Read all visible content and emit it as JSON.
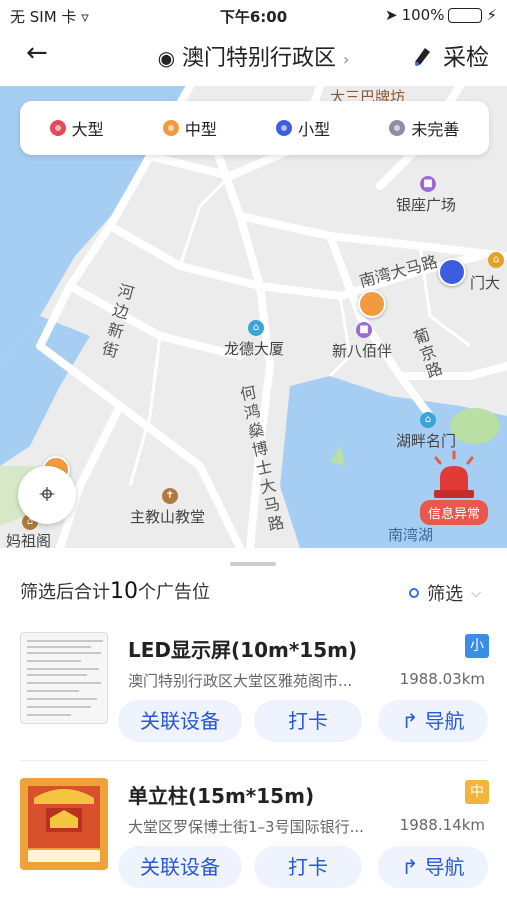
{
  "status": {
    "carrier": "无 SIM 卡",
    "time": "下午6:00",
    "battery": "100%",
    "battery_level": 1.0
  },
  "nav": {
    "back_icon": "arrow-left-icon",
    "location": "澳门特别行政区",
    "collect_label": "采检"
  },
  "legend": [
    {
      "label": "大型",
      "color": "#e24a57"
    },
    {
      "label": "中型",
      "color": "#f19a3e"
    },
    {
      "label": "小型",
      "color": "#3c5de0"
    },
    {
      "label": "未完善",
      "color": "#8a8fa6"
    }
  ],
  "map": {
    "labels": {
      "top_street": "大三巴牌坊",
      "mall": "银座广场",
      "nanwan": "南湾大马路",
      "gate": "门大",
      "river_street": "河边新街",
      "longde": "龙德大厦",
      "xinbabai": "新八佰伴",
      "pujing": "葡京路",
      "hehongshen": "何鸿燊博士大马路",
      "hupan": "湖畔名门",
      "church": "主教山教堂",
      "mazu": "妈祖阁",
      "lake": "南湾湖"
    },
    "alarm_label": "信息异常"
  },
  "summary": {
    "prefix": "筛选后合计",
    "count": "10",
    "suffix": "个广告位",
    "filter_label": "筛选"
  },
  "cards": [
    {
      "title": "LED显示屏(10m*15m)",
      "badge": "小",
      "badge_color": "#3a8ee8",
      "address": "澳门特别行政区大堂区雅苑阁市...",
      "distance": "1988.03km",
      "btn_link": "关联设备",
      "btn_checkin": "打卡",
      "btn_nav": "导航"
    },
    {
      "title": "单立柱(15m*15m)",
      "badge": "中",
      "badge_color": "#f2b43a",
      "address": "大堂区罗保博士街1–3号国际银行...",
      "distance": "1988.14km",
      "btn_link": "关联设备",
      "btn_checkin": "打卡",
      "btn_nav": "导航"
    }
  ]
}
